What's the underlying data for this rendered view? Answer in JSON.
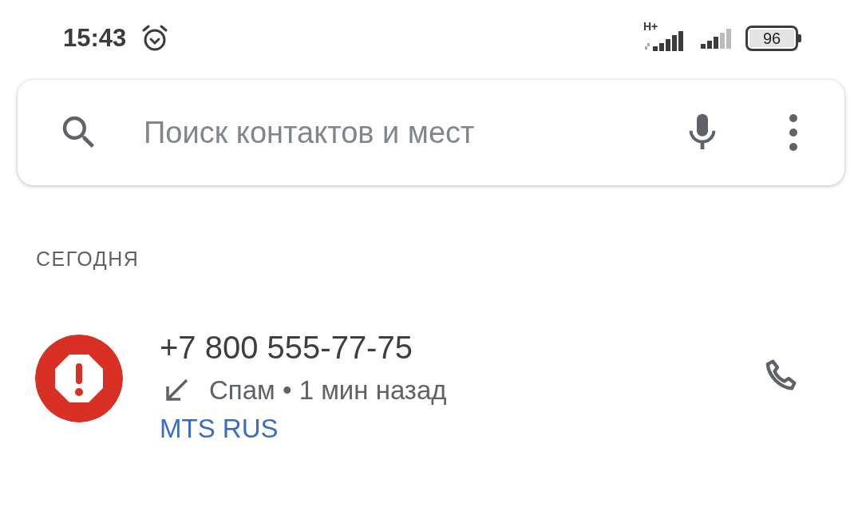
{
  "status_bar": {
    "time": "15:43",
    "network_type": "H+",
    "battery": "96"
  },
  "search": {
    "placeholder": "Поиск контактов и мест"
  },
  "sections": [
    {
      "title": "СЕГОДНЯ",
      "calls": [
        {
          "number": "+7 800 555-77-75",
          "kind": "incoming",
          "spam": true,
          "details": "Спам • 1 мин назад",
          "carrier": "MTS RUS"
        }
      ]
    }
  ]
}
